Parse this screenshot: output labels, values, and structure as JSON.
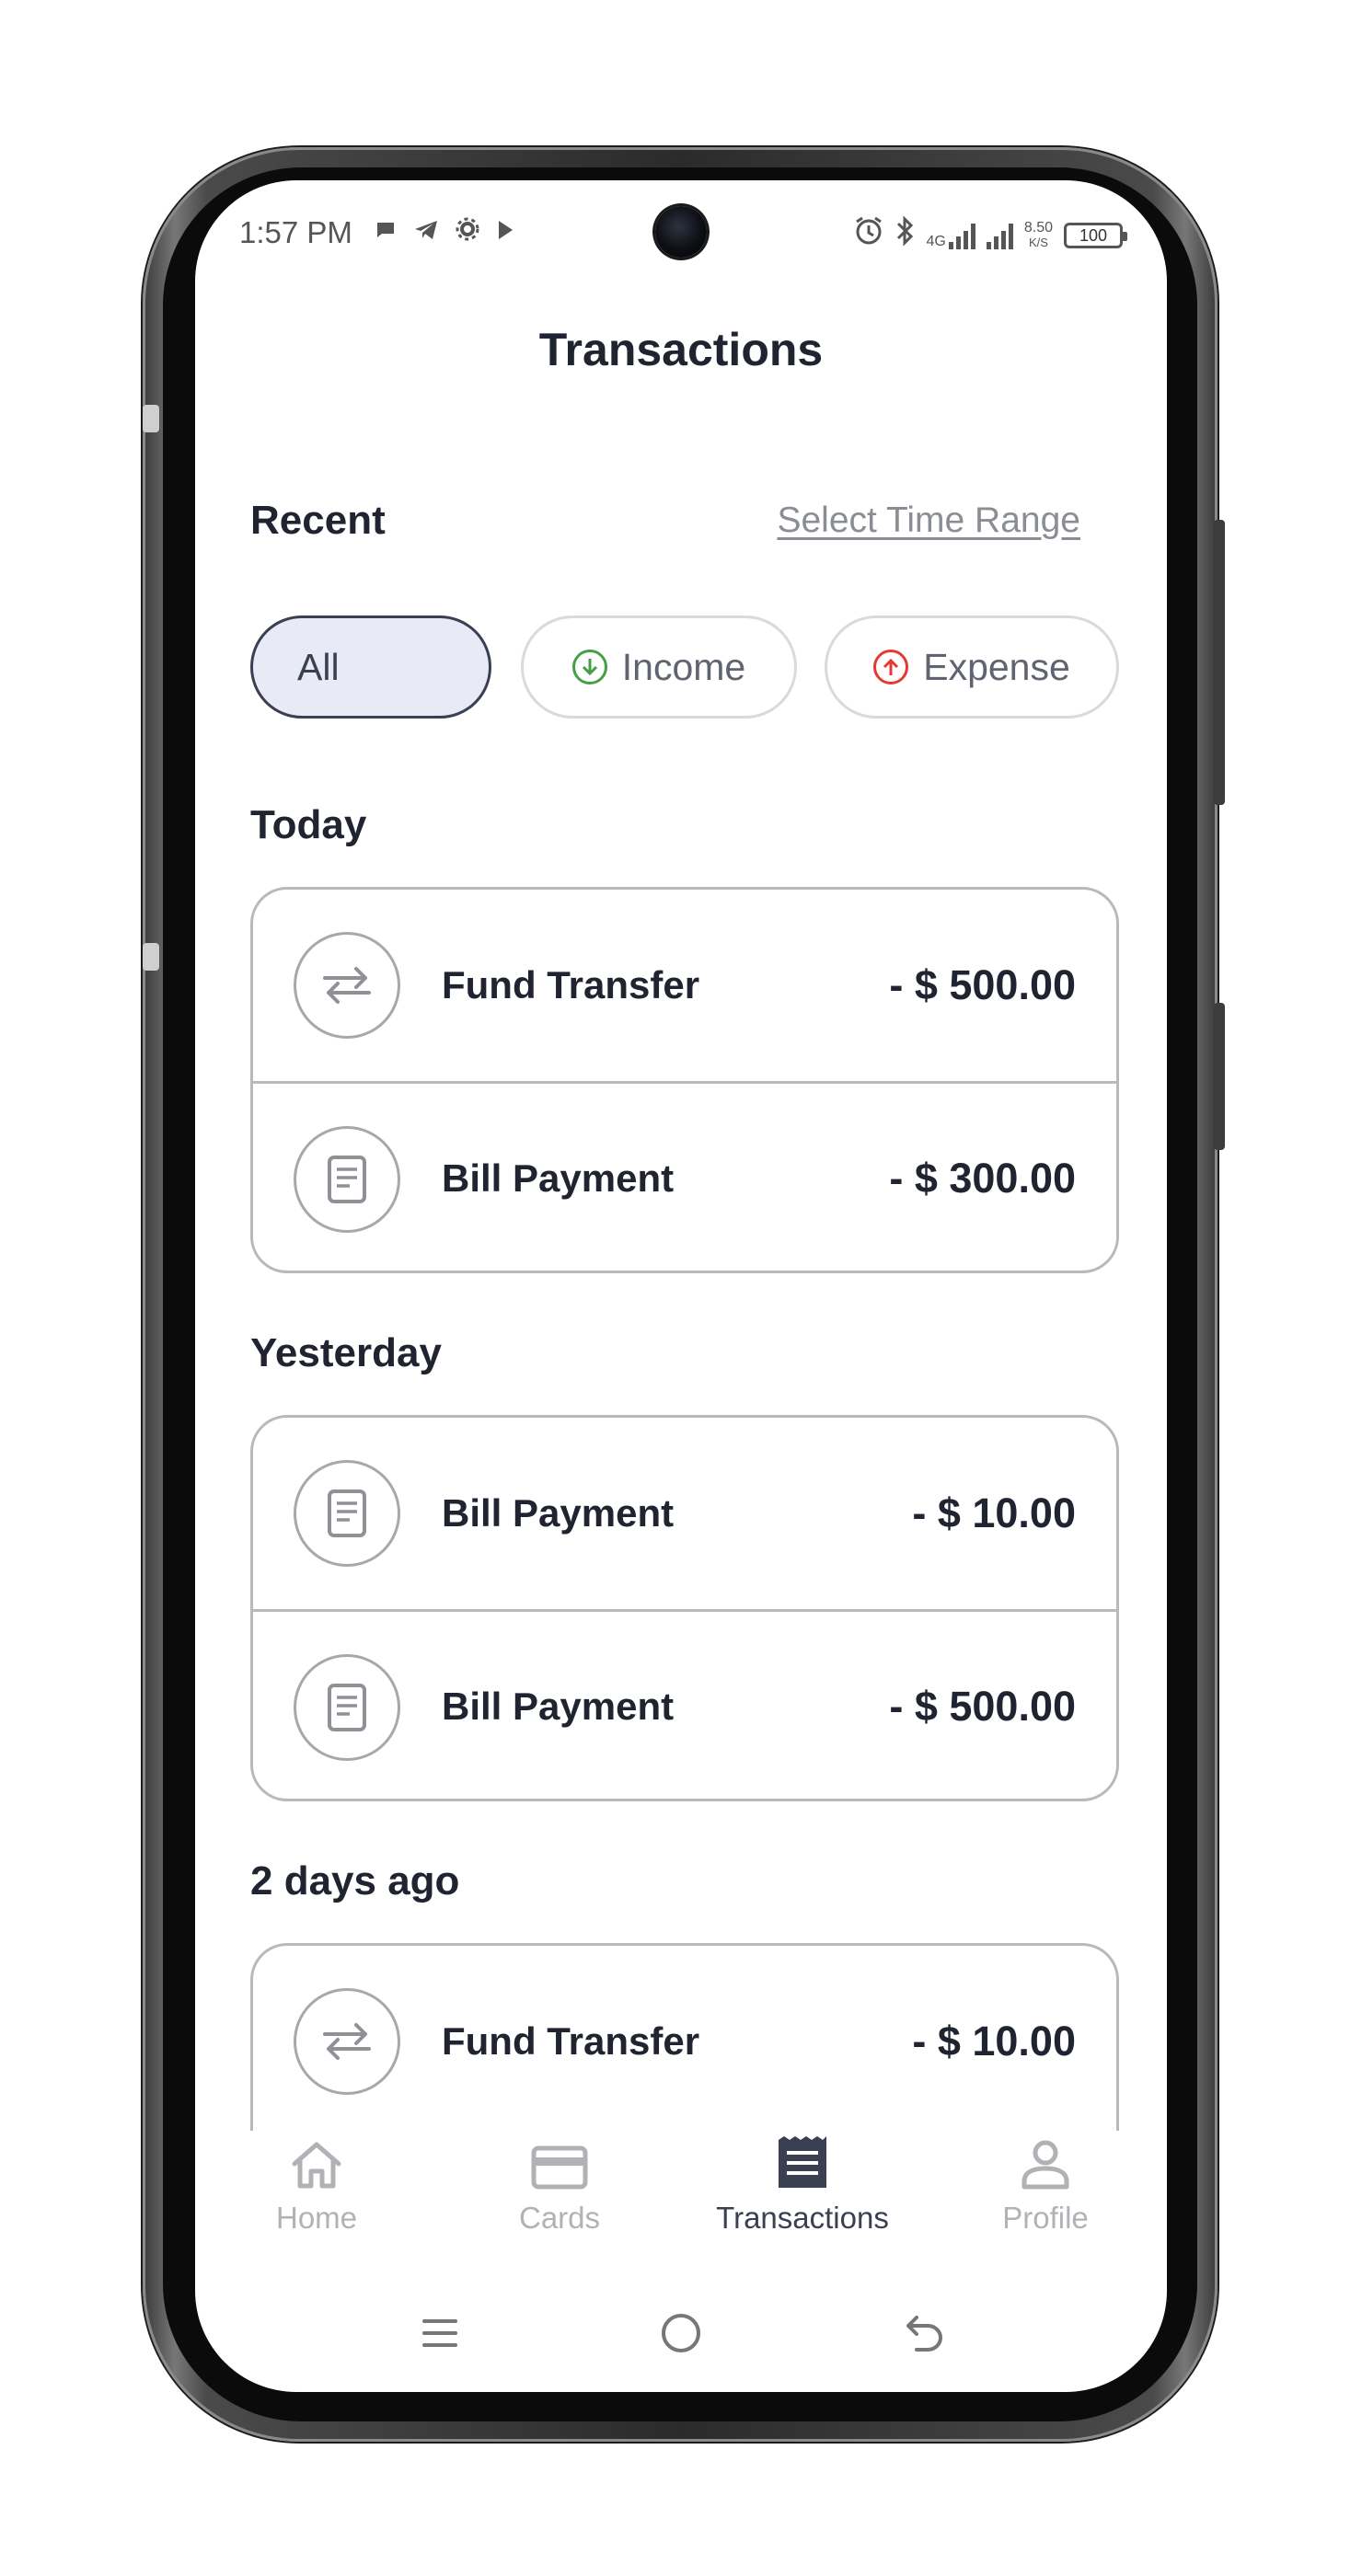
{
  "status_bar": {
    "time": "1:57 PM",
    "network_type": "4G",
    "speed_value": "8.50",
    "speed_unit": "K/S",
    "battery": "100"
  },
  "header": {
    "title": "Transactions"
  },
  "recent": {
    "label": "Recent",
    "time_range_link": "Select Time Range"
  },
  "filters": [
    {
      "label": "All",
      "active": true
    },
    {
      "label": "Income",
      "icon": "arrow-down-circle-icon",
      "color": "#43a047"
    },
    {
      "label": "Expense",
      "icon": "arrow-up-circle-icon",
      "color": "#e53935"
    }
  ],
  "groups": [
    {
      "title": "Today",
      "items": [
        {
          "title": "Fund Transfer",
          "amount": "- $ 500.00",
          "icon": "transfer-arrows-icon"
        },
        {
          "title": "Bill Payment",
          "amount": "- $ 300.00",
          "icon": "document-icon"
        }
      ]
    },
    {
      "title": "Yesterday",
      "items": [
        {
          "title": "Bill Payment",
          "amount": "- $ 10.00",
          "icon": "document-icon"
        },
        {
          "title": "Bill Payment",
          "amount": "- $ 500.00",
          "icon": "document-icon"
        }
      ]
    },
    {
      "title": "2 days ago",
      "items": [
        {
          "title": "Fund Transfer",
          "amount": "- $ 10.00",
          "icon": "transfer-arrows-icon"
        }
      ]
    }
  ],
  "bottom_nav": [
    {
      "label": "Home",
      "icon": "home-icon",
      "active": false
    },
    {
      "label": "Cards",
      "icon": "card-icon",
      "active": false
    },
    {
      "label": "Transactions",
      "icon": "receipt-icon",
      "active": true
    },
    {
      "label": "Profile",
      "icon": "person-icon",
      "active": false
    }
  ],
  "colors": {
    "text_primary": "#1f2430",
    "active_nav": "#3a3f52",
    "inactive_nav": "#b0b2b6",
    "active_chip_bg": "#e8eaf6",
    "income": "#43a047",
    "expense": "#e53935"
  }
}
